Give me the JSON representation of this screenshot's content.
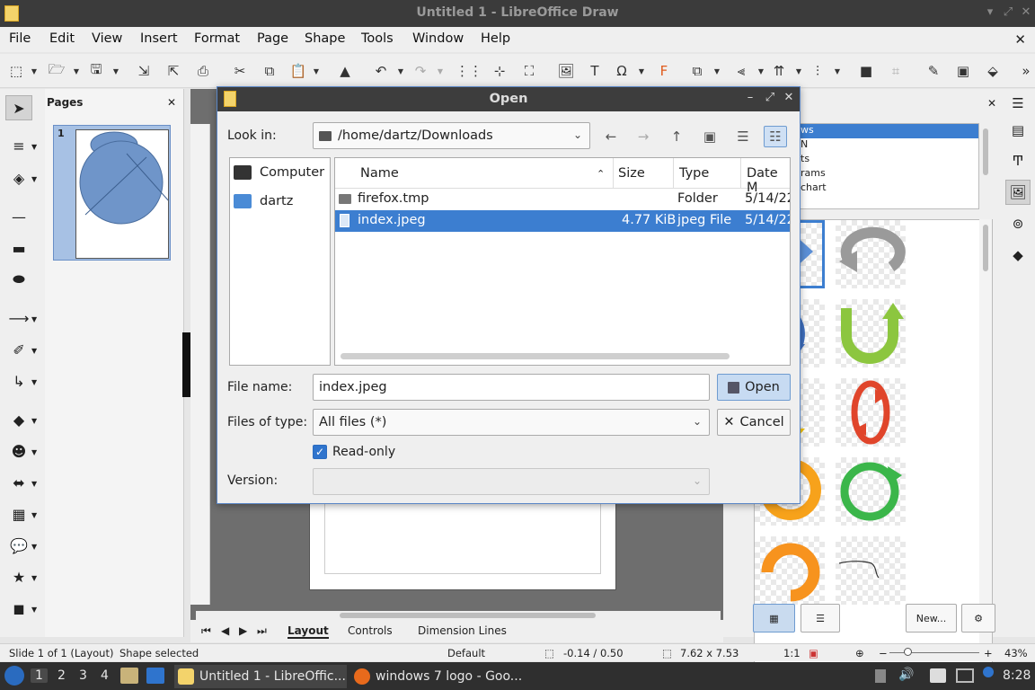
{
  "window": {
    "title": "Untitled 1 - LibreOffice Draw"
  },
  "menu": [
    "File",
    "Edit",
    "View",
    "Insert",
    "Format",
    "Page",
    "Shape",
    "Tools",
    "Window",
    "Help"
  ],
  "pages_panel": {
    "title": "Pages",
    "page_number": "1"
  },
  "sheet_tabs": {
    "layout": "Layout",
    "controls": "Controls",
    "dimension_lines": "Dimension Lines"
  },
  "gallery": {
    "themes": [
      "Arrows",
      "BPMN",
      "Bullets",
      "Diagrams",
      "Flowchart"
    ],
    "visible_themes": [
      "ws",
      "N",
      "ts",
      "rams",
      "chart"
    ],
    "new_button": "New..."
  },
  "status": {
    "slide": "Slide 1 of 1 (Layout)",
    "selection": "Shape selected",
    "style": "Default",
    "position": "-0.14 / 0.50",
    "size": "7.62 x 7.53",
    "scale": "1:1",
    "zoom": "43%"
  },
  "taskbar": {
    "workspaces": [
      "1",
      "2",
      "3",
      "4"
    ],
    "tasks": [
      "Untitled 1 - LibreOffic...",
      "windows 7 logo - Goo..."
    ],
    "clock": "8:28"
  },
  "dialog": {
    "title": "Open",
    "look_in_label": "Look in:",
    "look_in_value": "/home/dartz/Downloads",
    "places": [
      "Computer",
      "dartz"
    ],
    "columns": [
      "Name",
      "Size",
      "Type",
      "Date M"
    ],
    "files": [
      {
        "name": "firefox.tmp",
        "size": "",
        "type": "Folder",
        "date": "5/14/22"
      },
      {
        "name": "index.jpeg",
        "size": "4.77 KiB",
        "type": "jpeg File",
        "date": "5/14/22"
      }
    ],
    "file_name_label": "File name:",
    "file_name_value": "index.jpeg",
    "files_of_type_label": "Files of type:",
    "files_of_type_value": "All files (*)",
    "read_only_label": "Read-only",
    "version_label": "Version:",
    "open_button": "Open",
    "cancel_button": "Cancel"
  },
  "colors": {
    "accent": "#3c7ed0",
    "titlebar": "#3b3b3b",
    "taskbar": "#2f2f2f"
  }
}
